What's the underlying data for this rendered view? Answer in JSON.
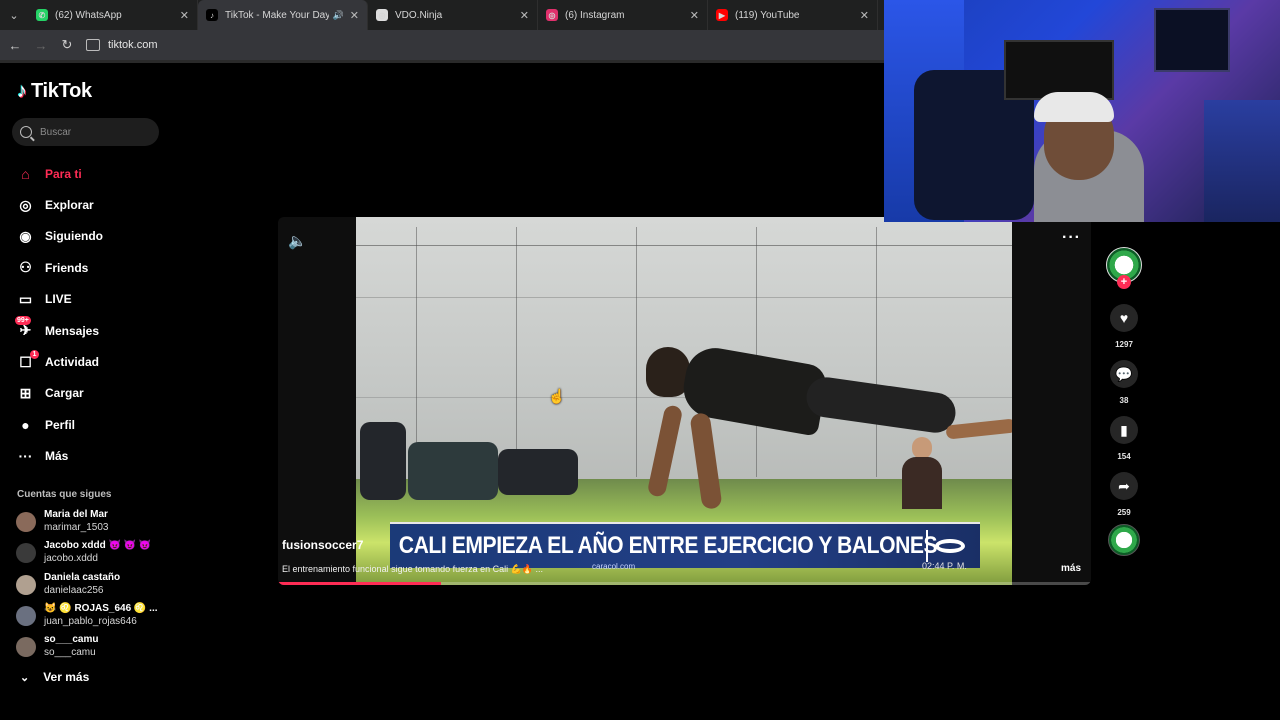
{
  "browser": {
    "tabs": [
      {
        "label": "(62) WhatsApp",
        "icon": "whatsapp-icon",
        "color": "#25d366",
        "glyph": "✆"
      },
      {
        "label": "TikTok - Make Your Day",
        "icon": "tiktok-icon",
        "color": "#000000",
        "glyph": "♪",
        "active": true,
        "audio": true
      },
      {
        "label": "VDO.Ninja",
        "icon": "vdoninja-icon",
        "color": "#dddddd",
        "glyph": "◎"
      },
      {
        "label": "(6) Instagram",
        "icon": "instagram-icon",
        "color": "#e1306c",
        "glyph": "◎"
      },
      {
        "label": "(119) YouTube",
        "icon": "youtube-icon",
        "color": "#ff0000",
        "glyph": "▶"
      }
    ],
    "url": "tiktok.com"
  },
  "sidebar": {
    "logo_text": "TikTok",
    "search_placeholder": "Buscar",
    "menu": [
      {
        "label": "Para ti",
        "icon": "home-icon",
        "glyph": "⌂",
        "active": true
      },
      {
        "label": "Explorar",
        "icon": "compass-icon",
        "glyph": "◎"
      },
      {
        "label": "Siguiendo",
        "icon": "following-icon",
        "glyph": "◉"
      },
      {
        "label": "Friends",
        "icon": "friends-icon",
        "glyph": "⚇"
      },
      {
        "label": "LIVE",
        "icon": "live-icon",
        "glyph": "▭"
      },
      {
        "label": "Mensajes",
        "icon": "messages-icon",
        "glyph": "✈",
        "badge": "99+"
      },
      {
        "label": "Actividad",
        "icon": "activity-icon",
        "glyph": "☐",
        "badge_dot": "1"
      },
      {
        "label": "Cargar",
        "icon": "upload-icon",
        "glyph": "⊞"
      },
      {
        "label": "Perfil",
        "icon": "profile-icon",
        "glyph": "●"
      },
      {
        "label": "Más",
        "icon": "more-icon",
        "glyph": "···"
      }
    ],
    "following_heading": "Cuentas que sigues",
    "accounts": [
      {
        "name": "Maria del Mar",
        "handle": "marimar_1503",
        "color": "#8a6a5a"
      },
      {
        "name": "Jacobo xddd 😈 😈 😈",
        "handle": "jacobo.xddd",
        "color": "#3a3a3a"
      },
      {
        "name": "Daniela castaño",
        "handle": "danielaac256",
        "color": "#b0a090"
      },
      {
        "name": "😺 ♌ ROJAS_646 ♌ ...",
        "handle": "juan_pablo_rojas646",
        "color": "#6a7080"
      },
      {
        "name": "so___camu",
        "handle": "so___camu",
        "color": "#7a6a60"
      }
    ],
    "see_more": "Ver más"
  },
  "video": {
    "author": "fusionsoccer7",
    "description": "El entrenamiento funcional sigue tomando fuerza en Cali 💪🔥 ...",
    "more_label": "más",
    "overlay_headline": "CALI EMPIEZA EL AÑO ENTRE EJERCICIO Y BALONES",
    "overlay_site": "caracol.com",
    "overlay_time": "02:44 P. M.",
    "progress": 0.2
  },
  "actions": {
    "likes": "1297",
    "comments": "38",
    "saves": "154",
    "shares": "259"
  }
}
